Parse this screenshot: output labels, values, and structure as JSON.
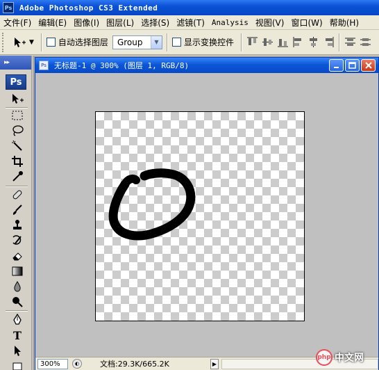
{
  "app": {
    "title": "Adobe Photoshop CS3 Extended",
    "ps_badge": "Ps"
  },
  "menu": [
    "文件(F)",
    "编辑(E)",
    "图像(I)",
    "图层(L)",
    "选择(S)",
    "滤镜(T)",
    "Analysis",
    "视图(V)",
    "窗口(W)",
    "帮助(H)"
  ],
  "options": {
    "auto_select_label": "自动选择图层",
    "auto_select_mode": "Group",
    "show_transform_label": "显示变换控件"
  },
  "toolbox": {
    "logo": "Ps",
    "tools": [
      "move-tool",
      "marquee-tool",
      "lasso-tool",
      "magic-wand-tool",
      "crop-tool",
      "eyedropper-tool",
      "healing-brush-tool",
      "brush-tool",
      "clone-stamp-tool",
      "history-brush-tool",
      "eraser-tool",
      "gradient-tool",
      "blur-tool",
      "dodge-tool",
      "pen-tool",
      "type-tool",
      "path-selection-tool"
    ],
    "type_tool_glyph": "T"
  },
  "document": {
    "title": "无标题-1 @ 300% (图层 1, RGB/8)",
    "zoom": "300%",
    "doc_info": "文档:29.3K/665.2K"
  },
  "watermark": {
    "logo_text": "php",
    "site": "中文网"
  },
  "colors": {
    "titlebar": "#0a52d6",
    "chrome": "#ece9d8",
    "workspace": "#c0c0c0"
  }
}
